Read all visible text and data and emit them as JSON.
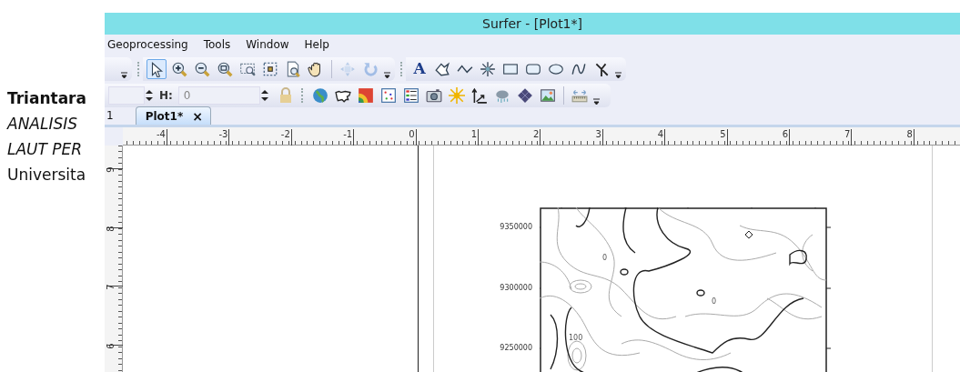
{
  "document": {
    "lines": [
      {
        "text": "Triantara",
        "kind": "author"
      },
      {
        "text": "ANALISIS",
        "kind": "title"
      },
      {
        "text": "LAUT PER",
        "kind": "title"
      },
      {
        "text": "Universita",
        "kind": "affiliation"
      }
    ]
  },
  "window": {
    "title": "Surfer - [Plot1*]"
  },
  "menu": [
    "Geoprocessing",
    "Tools",
    "Window",
    "Help"
  ],
  "toolbar_1": [
    {
      "kind": "pointer",
      "selected": true,
      "disabled": false
    },
    {
      "kind": "zoom-in",
      "selected": false,
      "disabled": false
    },
    {
      "kind": "zoom-out",
      "selected": false,
      "disabled": false
    },
    {
      "kind": "zoom-fit",
      "selected": false,
      "disabled": false
    },
    {
      "kind": "zoom-rect",
      "selected": false,
      "disabled": false
    },
    {
      "kind": "fit-frame",
      "selected": false,
      "disabled": false
    },
    {
      "kind": "preview",
      "selected": false,
      "disabled": false
    },
    {
      "kind": "hand",
      "selected": false,
      "disabled": false
    },
    {
      "kind": "sep"
    },
    {
      "kind": "move",
      "selected": false,
      "disabled": true
    },
    {
      "kind": "rotate",
      "selected": false,
      "disabled": true
    },
    {
      "kind": "overflow"
    }
  ],
  "toolbar_2": [
    {
      "kind": "text",
      "label": "A"
    },
    {
      "kind": "polygon"
    },
    {
      "kind": "polyline"
    },
    {
      "kind": "symbol"
    },
    {
      "kind": "rectangle"
    },
    {
      "kind": "rounded-rectangle"
    },
    {
      "kind": "ellipse"
    },
    {
      "kind": "spline"
    },
    {
      "kind": "reshape"
    },
    {
      "kind": "overflow"
    }
  ],
  "size_fields": [
    {
      "label": "H:",
      "value": "0"
    }
  ],
  "toolbar_3": [
    {
      "kind": "globe"
    },
    {
      "kind": "outline-map"
    },
    {
      "kind": "color-map"
    },
    {
      "kind": "post-map"
    },
    {
      "kind": "legend"
    },
    {
      "kind": "camera"
    },
    {
      "kind": "sun"
    },
    {
      "kind": "vector"
    },
    {
      "kind": "rain"
    },
    {
      "kind": "grid"
    },
    {
      "kind": "image"
    },
    {
      "kind": "sep"
    },
    {
      "kind": "ruler"
    },
    {
      "kind": "overflow"
    }
  ],
  "tabs": [
    {
      "label": "1",
      "selected": false
    },
    {
      "label": "Plot1*",
      "selected": true,
      "close": "×"
    }
  ],
  "rulers": {
    "horizontal": [
      "-4",
      "-3",
      "-2",
      "-1",
      "0",
      "1",
      "2",
      "3",
      "4",
      "5",
      "6",
      "7",
      "8"
    ],
    "vertical": [
      "9",
      "8",
      "7",
      "6"
    ]
  },
  "map": {
    "y_labels": [
      "9350000",
      "9300000",
      "9250000"
    ],
    "contour_labels": [
      "0",
      "0",
      "100"
    ]
  }
}
